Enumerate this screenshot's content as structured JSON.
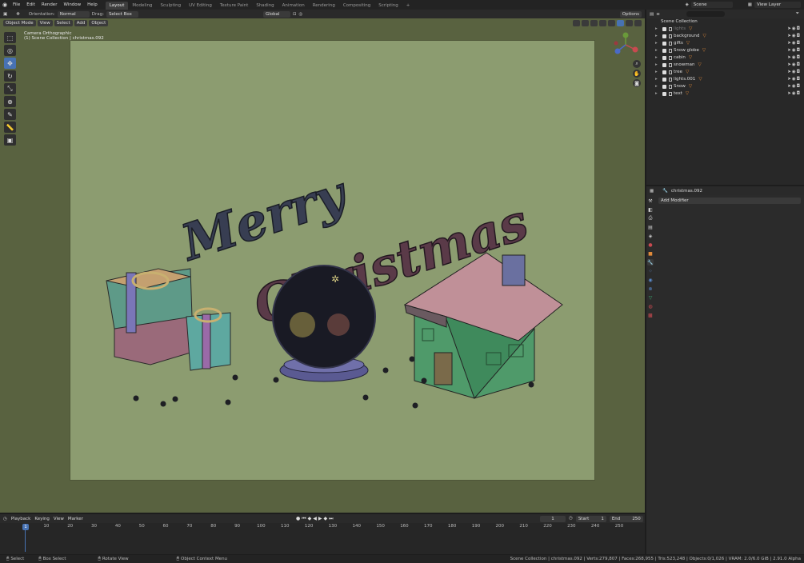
{
  "menubar": {
    "menus": [
      "File",
      "Edit",
      "Render",
      "Window",
      "Help"
    ],
    "workspaces": [
      "Layout",
      "Modeling",
      "Sculpting",
      "UV Editing",
      "Texture Paint",
      "Shading",
      "Animation",
      "Rendering",
      "Compositing",
      "Scripting"
    ],
    "active_workspace": "Layout",
    "scene_label": "Scene",
    "view_layer_label": "View Layer"
  },
  "viewport_header": {
    "orientation_label": "Orientation:",
    "orientation_value": "Normal",
    "drag_label": "Drag:",
    "drag_value": "Select Box",
    "pivot_value": "Global",
    "options_label": "Options"
  },
  "viewport_menu": {
    "mode": "Object Mode",
    "items": [
      "View",
      "Select",
      "Add",
      "Object"
    ]
  },
  "viewport_overlay": {
    "line1": "Camera Orthographic",
    "line2": "(1) Scene Collection | christmas.092"
  },
  "outliner": {
    "root": "Scene Collection",
    "items": [
      {
        "name": "lights",
        "disabled": true
      },
      {
        "name": "background",
        "disabled": false
      },
      {
        "name": "gifts",
        "disabled": false
      },
      {
        "name": "Snow globe",
        "disabled": false
      },
      {
        "name": "cabin",
        "disabled": false
      },
      {
        "name": "snowman",
        "disabled": false
      },
      {
        "name": "tree",
        "disabled": false
      },
      {
        "name": "lights.001",
        "disabled": false
      },
      {
        "name": "Snow",
        "disabled": false
      },
      {
        "name": "text",
        "disabled": false
      }
    ]
  },
  "properties": {
    "object_name": "christmas.092",
    "add_modifier_label": "Add Modifier"
  },
  "timeline": {
    "menus": [
      "Playback",
      "Keying",
      "View",
      "Marker"
    ],
    "current_frame": "1",
    "start_label": "Start",
    "start_value": "1",
    "end_label": "End",
    "end_value": "250",
    "ticks": [
      "1",
      "10",
      "20",
      "30",
      "40",
      "50",
      "60",
      "70",
      "80",
      "90",
      "100",
      "110",
      "120",
      "130",
      "140",
      "150",
      "160",
      "170",
      "180",
      "190",
      "200",
      "210",
      "220",
      "230",
      "240",
      "250"
    ]
  },
  "statusbar": {
    "items": [
      "Select",
      "Box Select",
      "Rotate View",
      "Object Context Menu"
    ],
    "stats": "Scene Collection | christmas.092 | Verts:279,807 | Faces:268,955 | Tris:523,248 | Objects:0/1,026 | VRAM: 2.0/6.0 GiB | 2.91.0 Alpha"
  },
  "scene_text": {
    "line1": "Merry",
    "line2": "Christmas"
  }
}
